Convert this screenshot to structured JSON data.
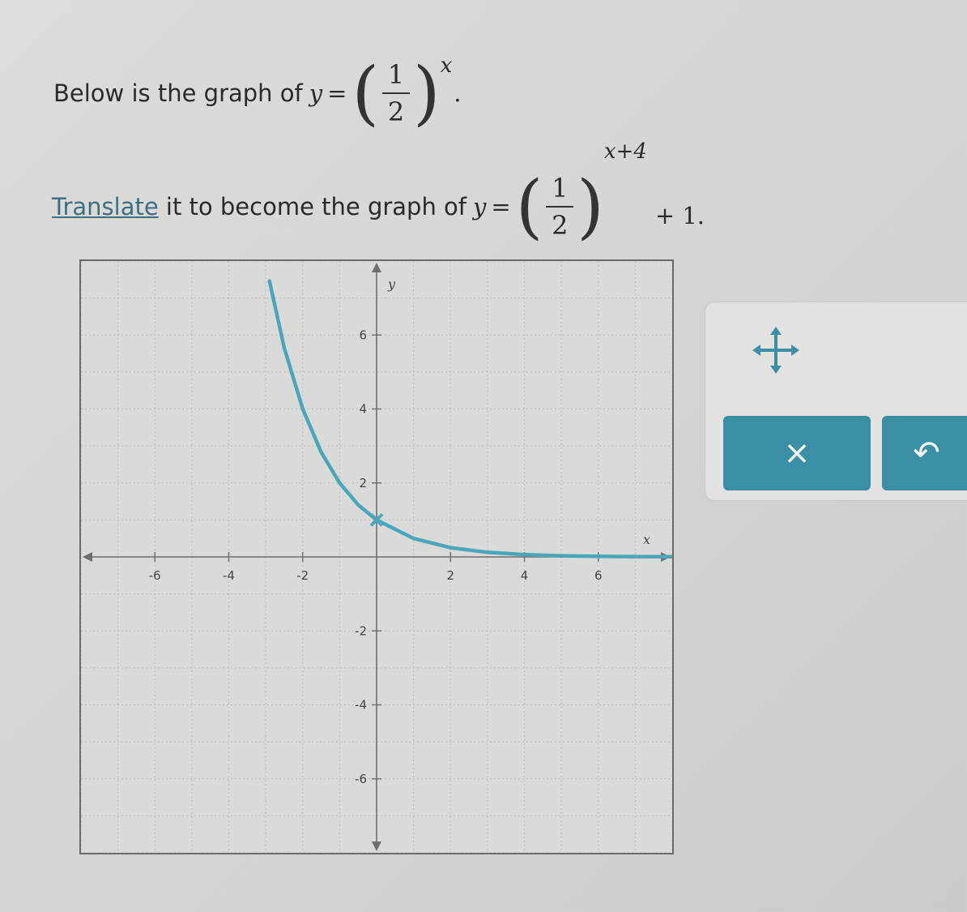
{
  "prompt": {
    "line1_text": "Below is the graph of",
    "line1_y": "y",
    "line1_eq": "=",
    "line1_num": "1",
    "line1_den": "2",
    "line1_exp": "x",
    "line1_end": ".",
    "line2_link": "Translate",
    "line2_text": " it to become the graph of",
    "line2_y": "y",
    "line2_eq": "=",
    "line2_num": "1",
    "line2_den": "2",
    "line2_exp": "x+4",
    "line2_tail": "+ 1."
  },
  "tools": {
    "move_icon": "move-arrows-icon",
    "clear_label": "×",
    "undo_label": "↶"
  },
  "colors": {
    "curve": "#4aa7bb",
    "button": "#3b8fa5",
    "link": "#3d6f82"
  },
  "chart_data": {
    "type": "line",
    "function": "y = (1/2)^x",
    "xlabel": "x",
    "ylabel": "y",
    "xlim": [
      -8,
      8
    ],
    "ylim": [
      -8,
      8
    ],
    "x_ticks": [
      "-6",
      "-4",
      "-2",
      "2",
      "4",
      "6"
    ],
    "y_ticks": [
      "6",
      "4",
      "2",
      "-2",
      "-4",
      "-6"
    ],
    "grid": true,
    "series": [
      {
        "x": [
          -2.9,
          -2.5,
          -2,
          -1.5,
          -1,
          -0.5,
          0,
          1,
          2,
          3,
          4,
          5,
          6,
          7,
          8
        ],
        "values": [
          7.46,
          5.66,
          4,
          2.83,
          2,
          1.41,
          1,
          0.5,
          0.25,
          0.125,
          0.0625,
          0.031,
          0.016,
          0.008,
          0.004
        ]
      }
    ],
    "movable_point": {
      "x": 0,
      "y": 1
    }
  }
}
